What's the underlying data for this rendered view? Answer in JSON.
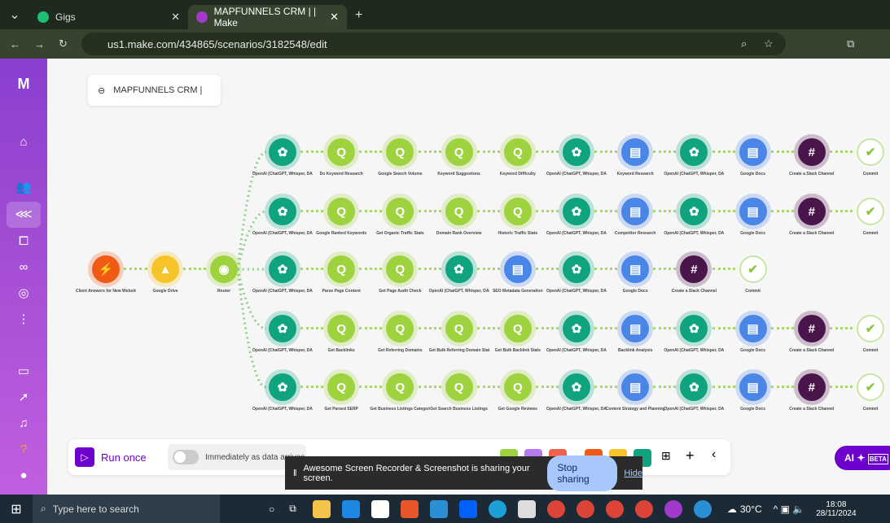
{
  "browser": {
    "tabs": [
      {
        "label": "Gigs",
        "active": false
      },
      {
        "label": "MAPFUNNELS CRM | | Make",
        "active": true
      }
    ],
    "url": "us1.make.com/434865/scenarios/3182548/edit"
  },
  "scenario": {
    "title": "MAPFUNNELS CRM |",
    "start": [
      {
        "label": "Client Answers for New Website Project",
        "type": "webhook"
      },
      {
        "label": "Google Drive",
        "type": "drive"
      },
      {
        "label": "Router",
        "type": "router"
      }
    ],
    "routes": [
      [
        {
          "label": "OpenAI (ChatGPT, Whisper, DALL-E)",
          "type": "openai"
        },
        {
          "label": "Do Keyword Research",
          "type": "seo"
        },
        {
          "label": "Google Search Volume",
          "type": "seo"
        },
        {
          "label": "Keyword Suggestions",
          "type": "seo"
        },
        {
          "label": "Keyword Difficulty",
          "type": "seo"
        },
        {
          "label": "OpenAI (ChatGPT, Whisper, DALL-E)",
          "type": "openai"
        },
        {
          "label": "Keyword Research",
          "type": "docs"
        },
        {
          "label": "OpenAI (ChatGPT, Whisper, DALL-E)",
          "type": "openai"
        },
        {
          "label": "Google Docs",
          "type": "docs"
        },
        {
          "label": "Create a Slack Channel",
          "type": "slack"
        },
        {
          "label": "Commit",
          "type": "commit"
        }
      ],
      [
        {
          "label": "OpenAI (ChatGPT, Whisper, DALL-E)",
          "type": "openai"
        },
        {
          "label": "Google Ranked Keywords",
          "type": "seo"
        },
        {
          "label": "Get Organic Traffic Stats",
          "type": "seo"
        },
        {
          "label": "Domain Rank Overview",
          "type": "seo"
        },
        {
          "label": "Historic Traffic Stats",
          "type": "seo"
        },
        {
          "label": "OpenAI (ChatGPT, Whisper, DALL-E)",
          "type": "openai"
        },
        {
          "label": "Competitor Research",
          "type": "docs"
        },
        {
          "label": "OpenAI (ChatGPT, Whisper, DALL-E)",
          "type": "openai"
        },
        {
          "label": "Google Docs",
          "type": "docs"
        },
        {
          "label": "Create a Slack Channel",
          "type": "slack"
        },
        {
          "label": "Commit",
          "type": "commit"
        }
      ],
      [
        {
          "label": "OpenAI (ChatGPT, Whisper, DALL-E)",
          "type": "openai"
        },
        {
          "label": "Parse Page Content",
          "type": "seo"
        },
        {
          "label": "Get Page Audit Check",
          "type": "seo"
        },
        {
          "label": "OpenAI (ChatGPT, Whisper, DALL-E)",
          "type": "openai"
        },
        {
          "label": "SEO Metadata Generation",
          "type": "docs"
        },
        {
          "label": "OpenAI (ChatGPT, Whisper, DALL-E)",
          "type": "openai"
        },
        {
          "label": "Google Docs",
          "type": "docs"
        },
        {
          "label": "Create a Slack Channel",
          "type": "slack"
        },
        {
          "label": "Commit",
          "type": "commit"
        }
      ],
      [
        {
          "label": "OpenAI (ChatGPT, Whisper, DALL-E)",
          "type": "openai"
        },
        {
          "label": "Get Backlinks",
          "type": "seo"
        },
        {
          "label": "Get Referring Domains",
          "type": "seo"
        },
        {
          "label": "Get Bulk Referring Domain Stats",
          "type": "seo"
        },
        {
          "label": "Get Bulk Backlink Stats",
          "type": "seo"
        },
        {
          "label": "OpenAI (ChatGPT, Whisper, DALL-E)",
          "type": "openai"
        },
        {
          "label": "Backlink Analysis",
          "type": "docs"
        },
        {
          "label": "OpenAI (ChatGPT, Whisper, DALL-E)",
          "type": "openai"
        },
        {
          "label": "Google Docs",
          "type": "docs"
        },
        {
          "label": "Create a Slack Channel",
          "type": "slack"
        },
        {
          "label": "Commit",
          "type": "commit"
        }
      ],
      [
        {
          "label": "OpenAI (ChatGPT, Whisper, DALL-E)",
          "type": "openai"
        },
        {
          "label": "Get Parsed SERP",
          "type": "seo"
        },
        {
          "label": "Get Business Listings Categories Aggregation",
          "type": "seo"
        },
        {
          "label": "Get Search Business Listings",
          "type": "seo"
        },
        {
          "label": "Get Google Reviews",
          "type": "seo"
        },
        {
          "label": "OpenAI (ChatGPT, Whisper, DALL-E)",
          "type": "openai"
        },
        {
          "label": "Content Strategy and Planning",
          "type": "docs"
        },
        {
          "label": "OpenAI (ChatGPT, Whisper, DALL-E)",
          "type": "openai"
        },
        {
          "label": "Google Docs",
          "type": "docs"
        },
        {
          "label": "Create a Slack Channel",
          "type": "slack"
        },
        {
          "label": "Commit",
          "type": "commit"
        }
      ]
    ]
  },
  "colors": {
    "openai": "#10a37f",
    "seo": "#9ed23f",
    "docs": "#4a86e8",
    "slack": "#4a154b",
    "commit": "#ffffff",
    "webhook": "#f05a14",
    "drive": "#f6c428",
    "router": "#9ed23f"
  },
  "toolbar": {
    "run_label": "Run once",
    "schedule_label": "Immediately as data arrives"
  },
  "share_bar": {
    "text": "Awesome Screen Recorder & Screenshot is sharing your screen.",
    "stop": "Stop sharing",
    "hide": "Hide"
  },
  "ai_button": {
    "label": "AI",
    "badge": "BETA"
  },
  "taskbar": {
    "search_placeholder": "Type here to search",
    "weather": "30°C",
    "time": "18:08",
    "date": "28/11/2024"
  }
}
